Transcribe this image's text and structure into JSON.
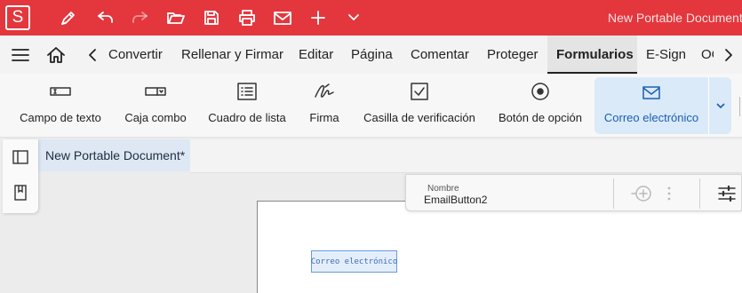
{
  "titlebar": {
    "app_logo": "S",
    "document_title": "New Portable Document",
    "quick_access": [
      "pen-icon",
      "undo-icon",
      "redo-icon",
      "open-folder-icon",
      "save-icon",
      "print-icon",
      "mail-icon",
      "plus-icon",
      "chevron-down-icon"
    ]
  },
  "menubar": {
    "tabs": [
      "Convertir",
      "Rellenar y Firmar",
      "Editar",
      "Página",
      "Comentar",
      "Proteger",
      "Formularios",
      "E-Sign",
      "OCR"
    ],
    "active_tab": "Formularios"
  },
  "ribbon": {
    "buttons": [
      {
        "label": "Campo de texto",
        "icon": "text-field-icon"
      },
      {
        "label": "Caja combo",
        "icon": "combo-box-icon"
      },
      {
        "label": "Cuadro de lista",
        "icon": "list-box-icon"
      },
      {
        "label": "Firma",
        "icon": "signature-icon"
      },
      {
        "label": "Casilla de verificación",
        "icon": "checkbox-icon"
      },
      {
        "label": "Botón de opción",
        "icon": "radio-button-icon"
      },
      {
        "label": "Correo electrónico",
        "icon": "email-icon"
      }
    ],
    "active_button": "Correo electrónico"
  },
  "document": {
    "tab_title": "New Portable Document*",
    "field_text": "Correo electrónico"
  },
  "properties": {
    "name_label": "Nombre",
    "name_value": "EmailButton2"
  },
  "colors": {
    "titlebar": "#e3373d",
    "accent": "#1a5fb4",
    "active_button_bg": "#dbeaf8"
  }
}
